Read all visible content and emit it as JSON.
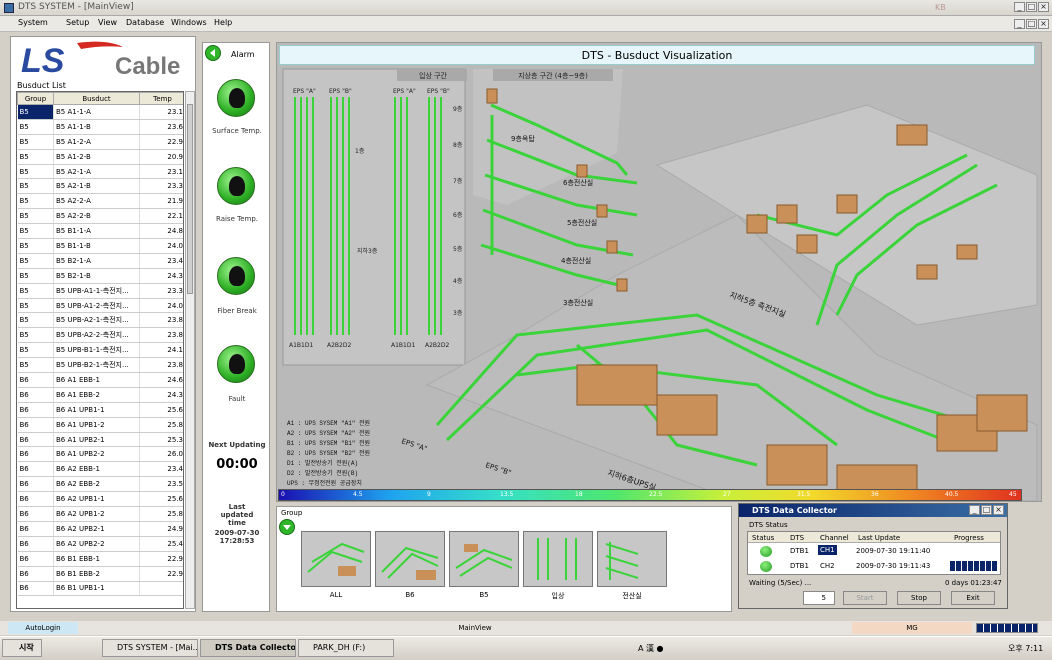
{
  "window": {
    "title": "DTS SYSTEM - [MainView]",
    "right_brand": "KB"
  },
  "menu": [
    "System",
    "Setup",
    "View",
    "Database",
    "Windows",
    "Help"
  ],
  "logo": {
    "ls": "LS",
    "cable": "Cable"
  },
  "busduct": {
    "label": "Busduct List",
    "columns": [
      "Group",
      "Busduct",
      "Temp"
    ],
    "rows": [
      [
        "B5",
        "B5 A1-1-A",
        "23.1"
      ],
      [
        "B5",
        "B5 A1-1-B",
        "23.6"
      ],
      [
        "B5",
        "B5 A1-2-A",
        "22.9"
      ],
      [
        "B5",
        "B5 A1-2-B",
        "20.9"
      ],
      [
        "B5",
        "B5 A2-1-A",
        "23.1"
      ],
      [
        "B5",
        "B5 A2-1-B",
        "23.3"
      ],
      [
        "B5",
        "B5 A2-2-A",
        "21.9"
      ],
      [
        "B5",
        "B5 A2-2-B",
        "22.1"
      ],
      [
        "B5",
        "B5 B1-1-A",
        "24.8"
      ],
      [
        "B5",
        "B5 B1-1-B",
        "24.0"
      ],
      [
        "B5",
        "B5 B2-1-A",
        "23.4"
      ],
      [
        "B5",
        "B5 B2-1-B",
        "24.3"
      ],
      [
        "B5",
        "B5 UPB-A1-1-측전지...",
        "23.3"
      ],
      [
        "B5",
        "B5 UPB-A1-2-측전지...",
        "24.0"
      ],
      [
        "B5",
        "B5 UPB-A2-1-측전지...",
        "23.8"
      ],
      [
        "B5",
        "B5 UPB-A2-2-측전지...",
        "23.8"
      ],
      [
        "B5",
        "B5 UPB-B1-1-측전지...",
        "24.1"
      ],
      [
        "B5",
        "B5 UPB-B2-1-측전지...",
        "23.8"
      ],
      [
        "B6",
        "B6 A1 EBB-1",
        "24.6"
      ],
      [
        "B6",
        "B6 A1 EBB-2",
        "24.3"
      ],
      [
        "B6",
        "B6 A1 UPB1-1",
        "25.6"
      ],
      [
        "B6",
        "B6 A1 UPB1-2",
        "25.8"
      ],
      [
        "B6",
        "B6 A1 UPB2-1",
        "25.3"
      ],
      [
        "B6",
        "B6 A1 UPB2-2",
        "26.0"
      ],
      [
        "B6",
        "B6 A2 EBB-1",
        "23.4"
      ],
      [
        "B6",
        "B6 A2 EBB-2",
        "23.5"
      ],
      [
        "B6",
        "B6 A2 UPB1-1",
        "25.6"
      ],
      [
        "B6",
        "B6 A2 UPB1-2",
        "25.8"
      ],
      [
        "B6",
        "B6 A2 UPB2-1",
        "24.9"
      ],
      [
        "B6",
        "B6 A2 UPB2-2",
        "25.4"
      ],
      [
        "B6",
        "B6 B1 EBB-1",
        "22.9"
      ],
      [
        "B6",
        "B6 B1 EBB-2",
        "22.9"
      ],
      [
        "B6",
        "B6 B1 UPB1-1",
        ""
      ]
    ]
  },
  "alarm": {
    "label": "Alarm",
    "items": [
      "Surface Temp.",
      "Raise Temp.",
      "Fiber Break",
      "Fault"
    ],
    "next_label": "Next Updating",
    "next_value": "00:00",
    "last_label": "Last updated time",
    "last_value": "2009-07-30 17:28:53"
  },
  "viz": {
    "title": "DTS - Busduct Visualization",
    "sec1": "입상 구간",
    "sec2": "지상층 구간 (4층~9층)",
    "eps_labels": [
      "EPS \"A\"",
      "EPS \"B\"",
      "EPS \"A\"",
      "EPS \"B\""
    ],
    "floors": [
      "9층",
      "8층",
      "7층",
      "6층",
      "5층",
      "4층",
      "3층"
    ],
    "bottom_labels": [
      "A1B1D1",
      "A2B2D2",
      "A1B1D1",
      "A2B2D2"
    ],
    "mid_labels": [
      "1층",
      "지하3층"
    ],
    "rooms": [
      "9층옥탑",
      "6층전산실",
      "5층전산실",
      "4층전산실",
      "3층전산실"
    ],
    "basement5": "지하5층 축전지실",
    "basement6": "지하6층UPS실",
    "eps_a": "EPS \"A\"",
    "eps_b": "EPS \"B\"",
    "legend": [
      "A1 : UPS SYSEM \"A1\" 전원",
      "A2 : UPS SYSEM \"A2\" 전원",
      "B1 : UPS SYSEM \"B1\" 전원",
      "B2 : UPS SYSEM \"B2\" 전원",
      "D1 : 발전방송기 전원(A)",
      "D2 : 발전방송기 전원(B)",
      "UPS : 무정전전원 공급장치"
    ],
    "scale": [
      "0",
      "4.5",
      "9",
      "13.5",
      "18",
      "22.5",
      "27",
      "31.5",
      "36",
      "40.5",
      "45"
    ]
  },
  "group": {
    "label": "Group",
    "thumbs": [
      "ALL",
      "B6",
      "B5",
      "입상",
      "전산실"
    ]
  },
  "collector": {
    "title": "DTS Data Collector",
    "section": "DTS Status",
    "cols": [
      "Status",
      "DTS",
      "Channel",
      "Last Update",
      "Progress"
    ],
    "rows": [
      [
        "DTB1",
        "CH1",
        "2009-07-30 19:11:40"
      ],
      [
        "DTB1",
        "CH2",
        "2009-07-30 19:11:43"
      ]
    ],
    "waiting": "Waiting (5/Sec) ...",
    "elapsed": "0 days 01:23:47",
    "spin": "5",
    "buttons": [
      "Start",
      "Stop",
      "Exit"
    ]
  },
  "status": {
    "left": "AutoLogin",
    "mid": "MainView",
    "right": "MG"
  },
  "taskbar": {
    "start": "시작",
    "tasks": [
      "DTS SYSTEM - [Mai...",
      "DTS Data Collector",
      "PARK_DH (F:)"
    ],
    "ime": "A 漢 ●",
    "time": "오후 7:11"
  },
  "colors": {
    "accent": "#3a6ea5",
    "pipe": "#3ad43a",
    "box": "#c9905a",
    "logo_blue": "#2a4aa0",
    "logo_red": "#d42a22"
  }
}
